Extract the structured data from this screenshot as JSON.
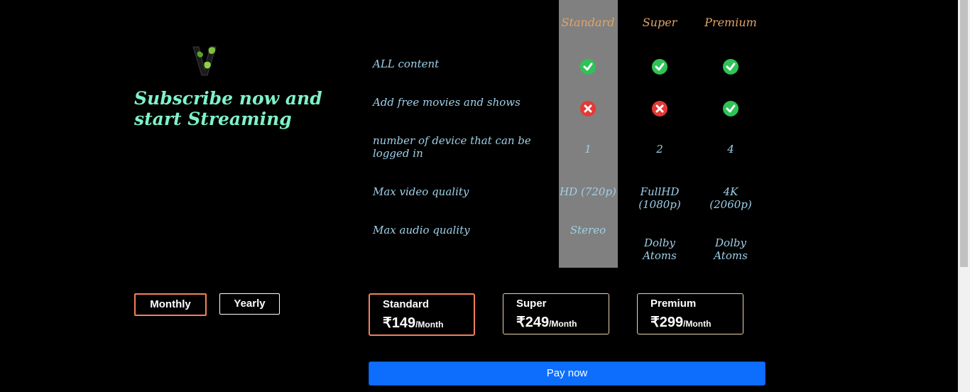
{
  "hero": {
    "headline": "Subscribe now and start Streaming"
  },
  "plans_header": [
    "Standard",
    "Super",
    "Premium"
  ],
  "features": [
    {
      "label": "ALL content",
      "values": [
        "check",
        "check",
        "check"
      ]
    },
    {
      "label": "Add free movies and shows",
      "values": [
        "cross",
        "cross",
        "check"
      ]
    },
    {
      "label": "number of device that can be logged in",
      "values": [
        "1",
        "2",
        "4"
      ]
    },
    {
      "label": "Max video quality",
      "values": [
        "HD (720p)",
        "FullHD (1080p)",
        "4K (2060p)"
      ]
    },
    {
      "label": "Max audio quality",
      "values": [
        "Stereo",
        "Dolby Atoms",
        "Dolby Atoms"
      ]
    }
  ],
  "billing": {
    "monthly": "Monthly",
    "yearly": "Yearly",
    "selected": "Monthly"
  },
  "cards": [
    {
      "name": "Standard",
      "price": "₹149",
      "unit": "/Month",
      "selected": true
    },
    {
      "name": "Super",
      "price": "₹249",
      "unit": "/Month",
      "selected": false
    },
    {
      "name": "Premium",
      "price": "₹299",
      "unit": "/Month",
      "selected": false
    }
  ],
  "pay_button": "Pay now",
  "colors": {
    "accent_orange": "#f0805a",
    "headline_green": "#7ef2c8",
    "plan_header": "#e0a56a",
    "pay_blue": "#0d6efd",
    "check_green": "#2fc257",
    "cross_red": "#e53935"
  },
  "icons": {
    "logo": "v-logo-icon",
    "check": "check-circle-icon",
    "cross": "x-circle-icon"
  }
}
